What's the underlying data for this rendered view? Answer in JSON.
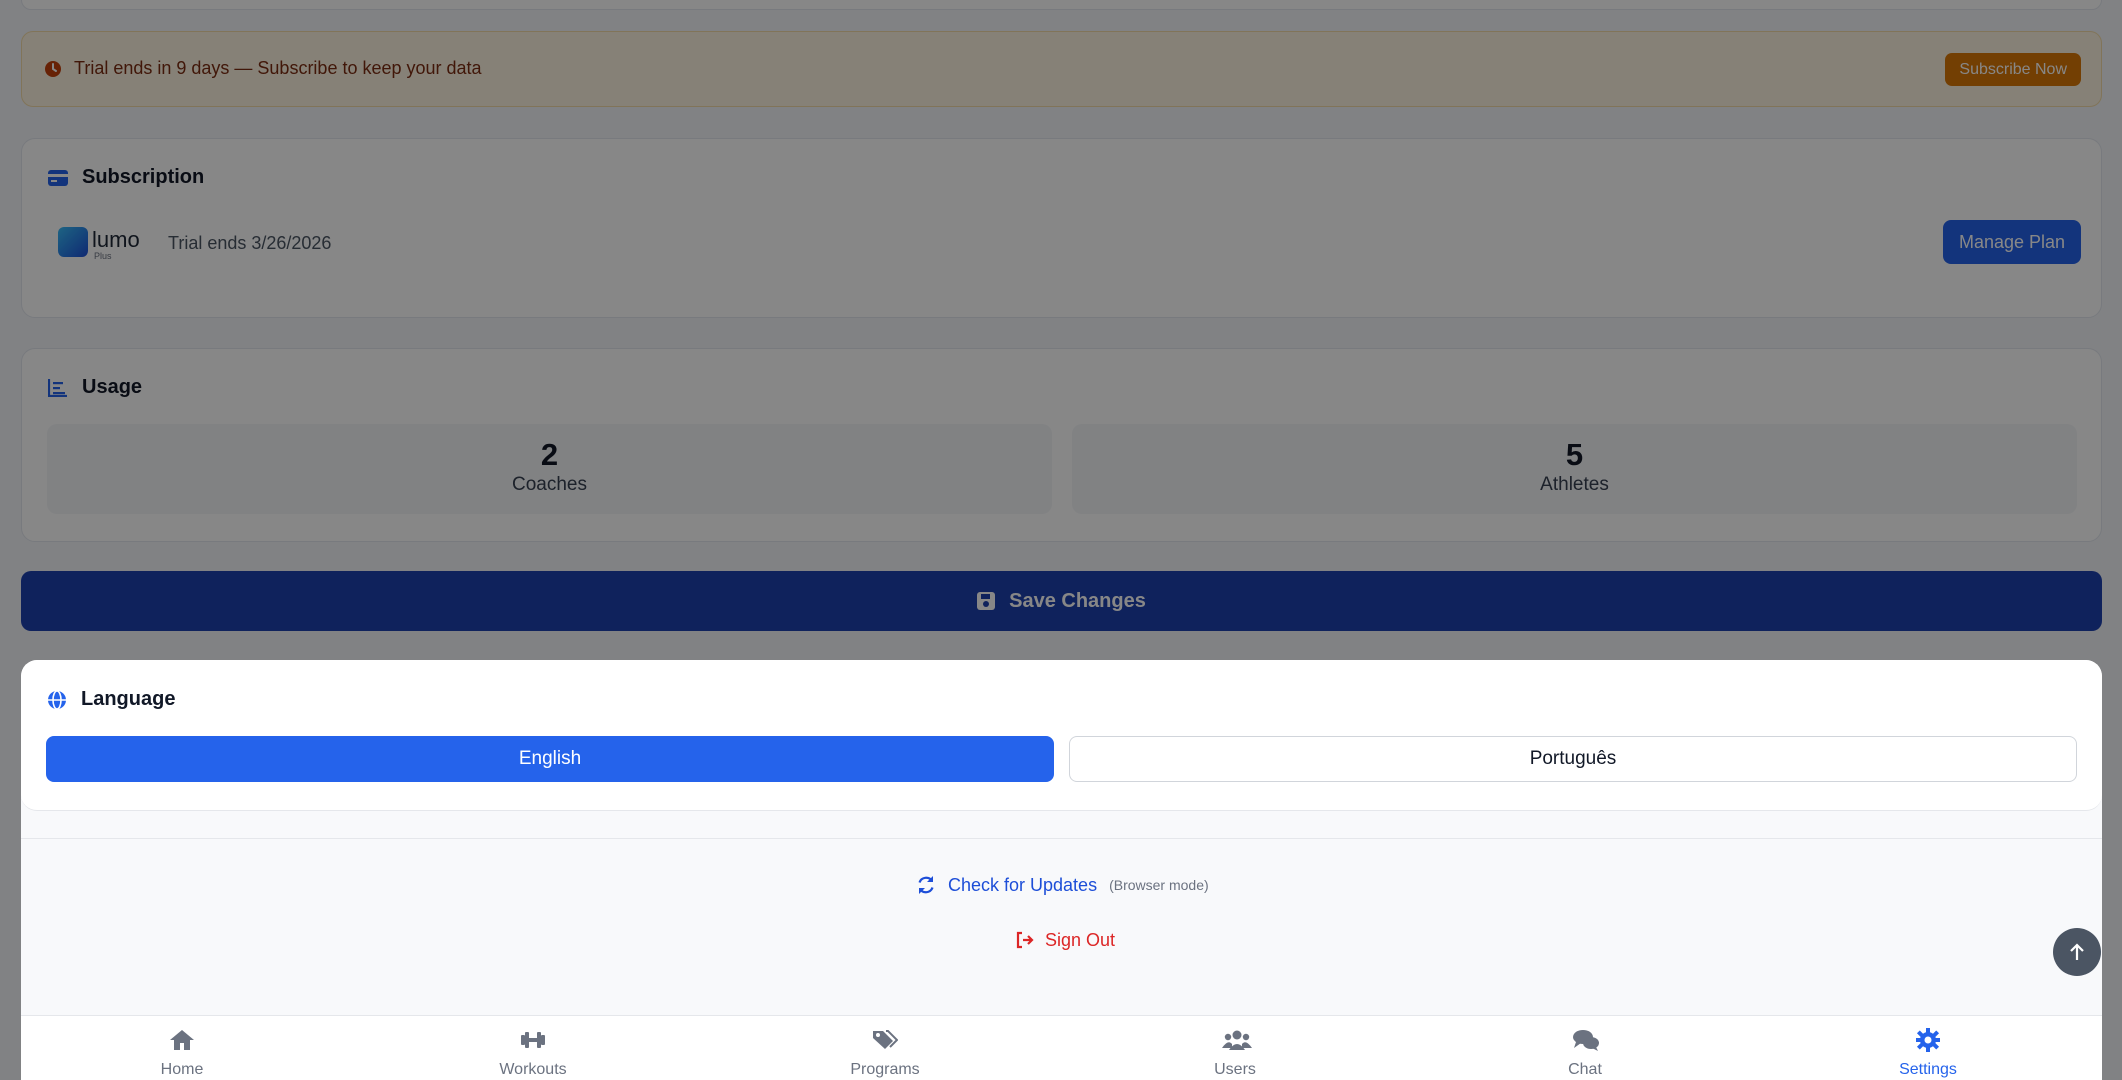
{
  "trial_banner": {
    "text": "Trial ends in 9 days — Subscribe to keep your data",
    "button": "Subscribe Now"
  },
  "subscription": {
    "title": "Subscription",
    "logo_text": "lumo",
    "logo_sub": "Plus",
    "trial_text": "Trial ends 3/26/2026",
    "manage_button": "Manage Plan"
  },
  "usage": {
    "title": "Usage",
    "stats": [
      {
        "value": "2",
        "label": "Coaches"
      },
      {
        "value": "5",
        "label": "Athletes"
      }
    ]
  },
  "save_button": "Save Changes",
  "language": {
    "title": "Language",
    "options": [
      {
        "label": "English",
        "selected": true
      },
      {
        "label": "Português",
        "selected": false
      }
    ]
  },
  "updates": {
    "label": "Check for Updates",
    "note": "(Browser mode)"
  },
  "sign_out": "Sign Out",
  "nav": [
    {
      "label": "Home",
      "icon": "home-icon"
    },
    {
      "label": "Workouts",
      "icon": "dumbbell-icon"
    },
    {
      "label": "Programs",
      "icon": "tags-icon"
    },
    {
      "label": "Users",
      "icon": "users-icon"
    },
    {
      "label": "Chat",
      "icon": "chat-icon"
    },
    {
      "label": "Settings",
      "icon": "gear-icon",
      "active": true
    }
  ],
  "colors": {
    "primary": "#2563eb",
    "primary_dark": "#1e3a8a",
    "warning": "#c2410c",
    "danger": "#dc2626"
  }
}
